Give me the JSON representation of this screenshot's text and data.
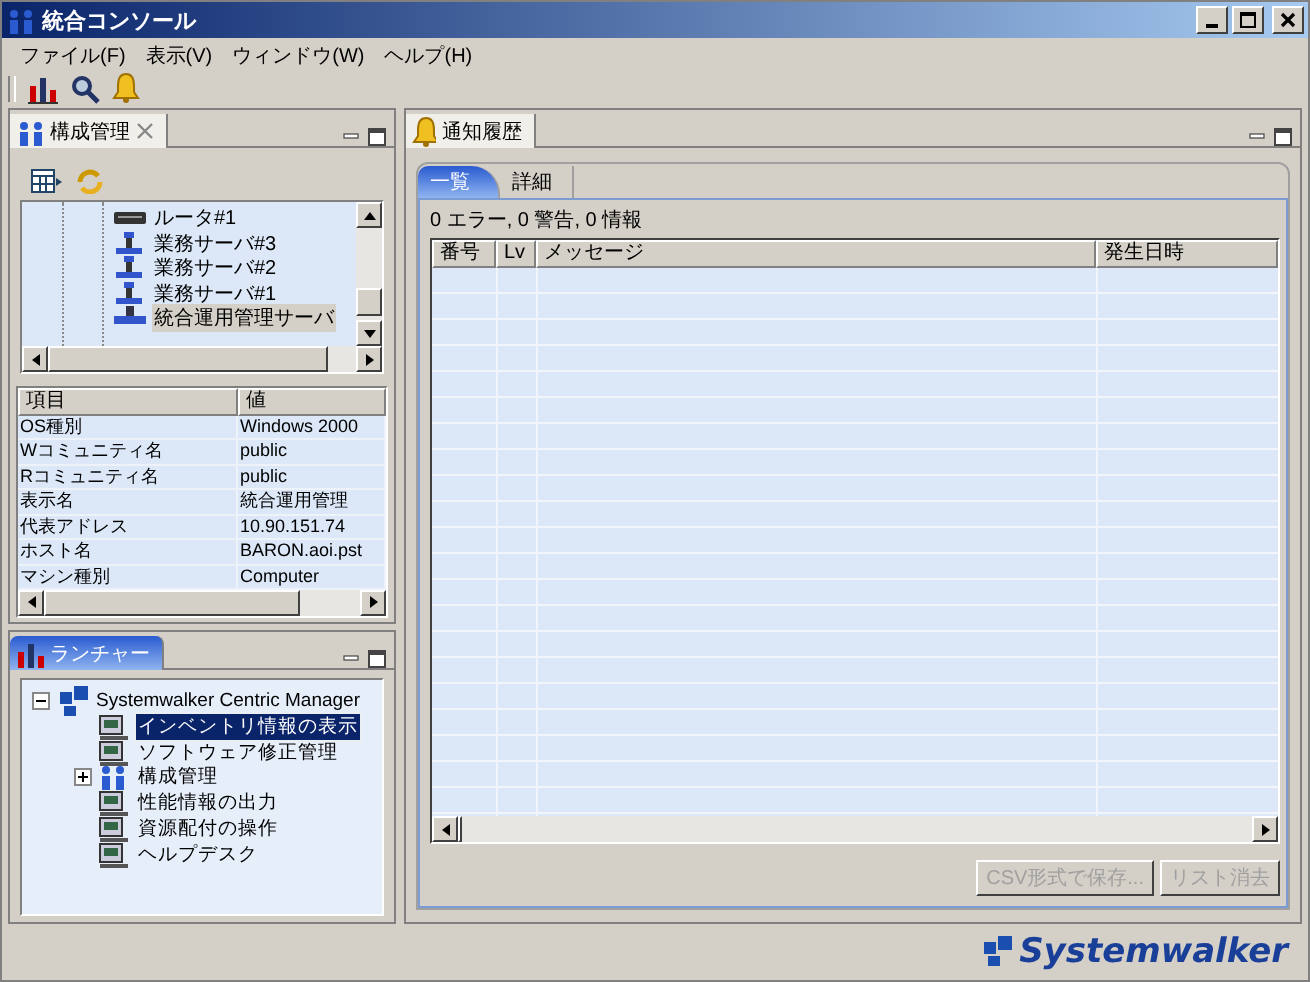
{
  "window": {
    "title": "統合コンソール"
  },
  "menu": [
    "ファイル(F)",
    "表示(V)",
    "ウィンドウ(W)",
    "ヘルプ(H)"
  ],
  "config_panel": {
    "tab": "構成管理",
    "tree": [
      {
        "label": "ルータ#1",
        "kind": "router",
        "selected": false
      },
      {
        "label": "業務サーバ#3",
        "kind": "server",
        "selected": false
      },
      {
        "label": "業務サーバ#2",
        "kind": "server",
        "selected": false
      },
      {
        "label": "業務サーバ#1",
        "kind": "server",
        "selected": false
      },
      {
        "label": "統合運用管理サーバ",
        "kind": "manager",
        "selected": true
      }
    ],
    "properties": {
      "columns": [
        "項目",
        "値"
      ],
      "rows": [
        [
          "OS種別",
          "Windows 2000"
        ],
        [
          "Wコミュニティ名",
          "public"
        ],
        [
          "Rコミュニティ名",
          "public"
        ],
        [
          "表示名",
          "統合運用管理"
        ],
        [
          "代表アドレス",
          "10.90.151.74"
        ],
        [
          "ホスト名",
          "BARON.aoi.pst"
        ],
        [
          "マシン種別",
          "Computer"
        ]
      ]
    }
  },
  "launcher": {
    "tab": "ランチャー",
    "root": {
      "label": "Systemwalker Centric Manager",
      "expanded": true,
      "children": [
        {
          "label": "インベントリ情報の表示",
          "kind": "leaf",
          "selected": true
        },
        {
          "label": "ソフトウェア修正管理",
          "kind": "leaf",
          "selected": false
        },
        {
          "label": "構成管理",
          "kind": "group",
          "expanded": false,
          "selected": false
        },
        {
          "label": "性能情報の出力",
          "kind": "leaf",
          "selected": false
        },
        {
          "label": "資源配付の操作",
          "kind": "leaf",
          "selected": false
        },
        {
          "label": "ヘルプデスク",
          "kind": "leaf",
          "selected": false
        }
      ]
    }
  },
  "history": {
    "tab": "通知履歴",
    "subtabs": [
      {
        "label": "一覧",
        "selected": true
      },
      {
        "label": "詳細",
        "selected": false
      }
    ],
    "summary": "0 エラー, 0 警告, 0 情報",
    "columns": [
      "番号",
      "Lv",
      "メッセージ",
      "発生日時"
    ],
    "buttons": [
      {
        "label": "CSV形式で保存...",
        "disabled": true
      },
      {
        "label": "リスト消去",
        "disabled": true
      }
    ]
  },
  "footer": {
    "logo": "Systemwalker"
  }
}
